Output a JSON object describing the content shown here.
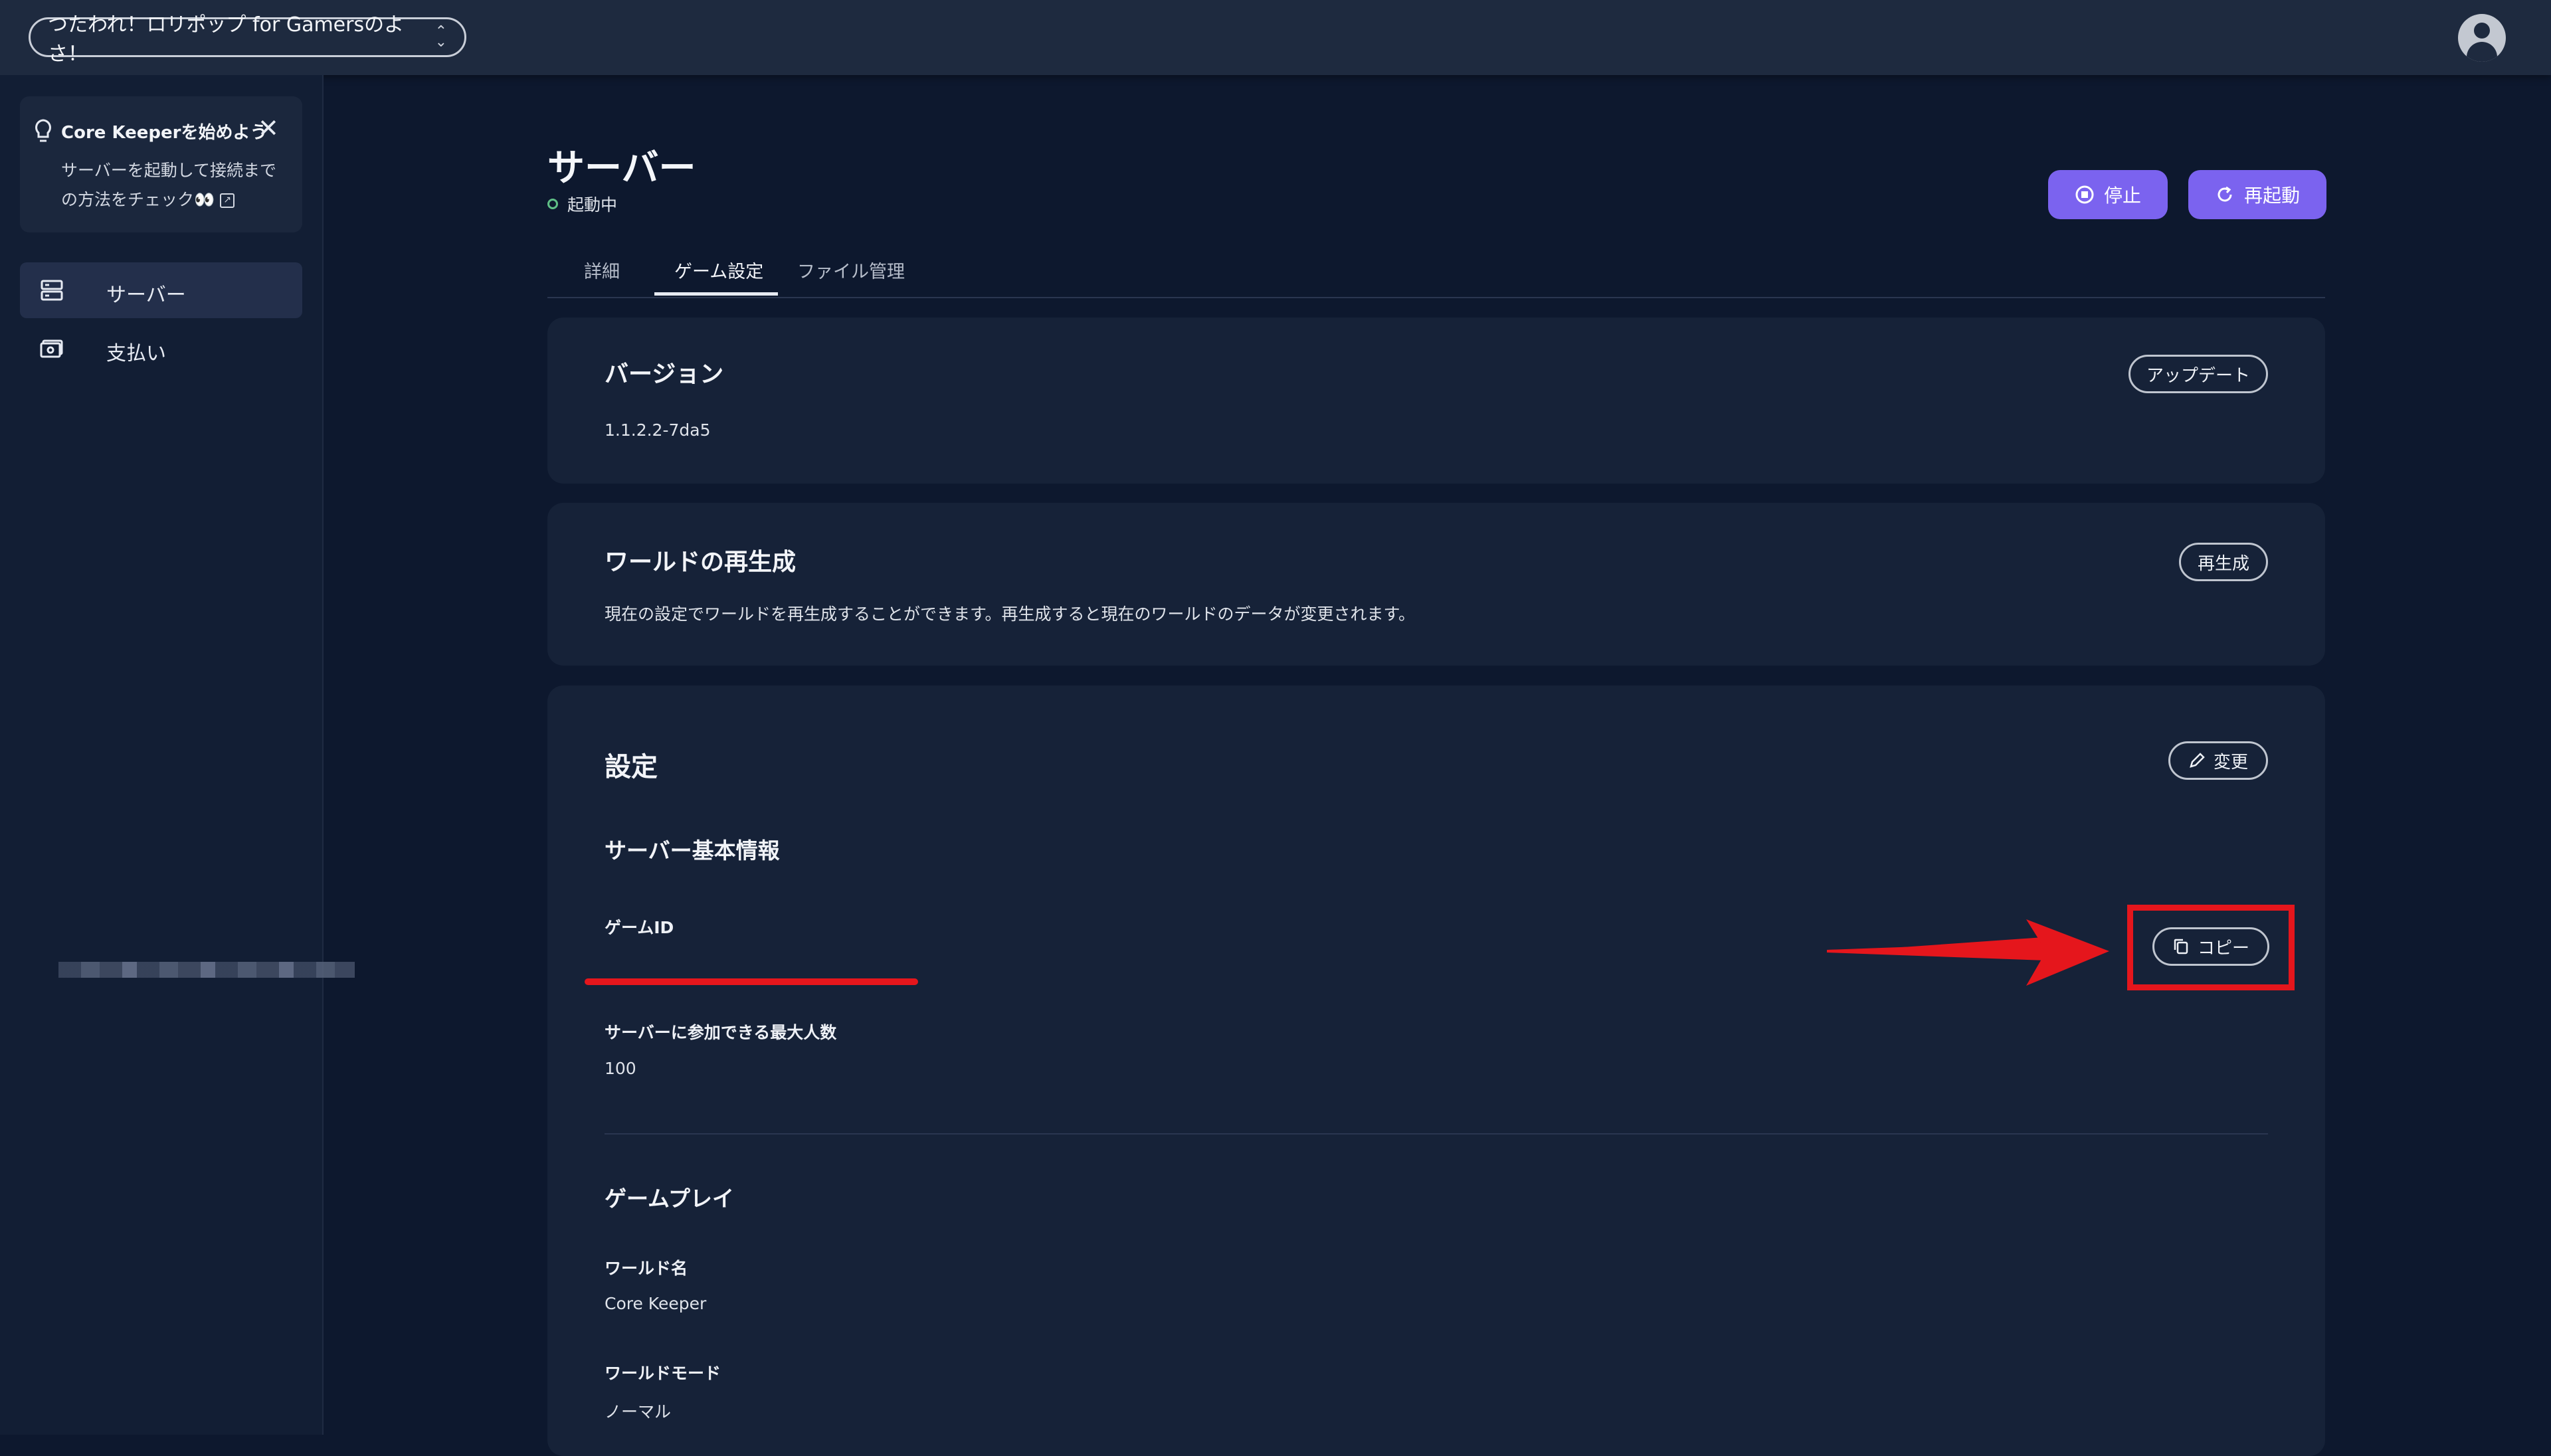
{
  "topbar": {
    "server_name": "つたわれ！ロリポップ for Gamersのよさ！",
    "select_icon": "chevron-up-down-icon",
    "avatar_icon": "user-avatar-icon"
  },
  "sidebar": {
    "tip": {
      "title": "Core Keeperを始めよう",
      "body_line1": "サーバーを起動して接続まで",
      "body_line2": "の方法をチェック👀",
      "icon": "lightbulb-icon",
      "close_icon": "close-icon"
    },
    "items": [
      {
        "label": "サーバー",
        "icon": "server-icon",
        "active": true
      },
      {
        "label": "支払い",
        "icon": "payment-icon",
        "active": false
      }
    ]
  },
  "header": {
    "title": "サーバー",
    "status": "起動中",
    "status_color": "#5fbf86",
    "stop_label": "停止",
    "restart_label": "再起動",
    "accent": "#7b63ef"
  },
  "tabs": [
    {
      "label": "詳細",
      "active": false
    },
    {
      "label": "ゲーム設定",
      "active": true
    },
    {
      "label": "ファイル管理",
      "active": false
    }
  ],
  "version_card": {
    "title": "バージョン",
    "value": "1.1.2.2-7da5",
    "button": "アップデート"
  },
  "regen_card": {
    "title": "ワールドの再生成",
    "description": "現在の設定でワールドを再生成することができます。再生成すると現在のワールドのデータが変更されます。",
    "button": "再生成"
  },
  "settings_card": {
    "title": "設定",
    "edit_button": "変更",
    "basic_section": "サーバー基本情報",
    "game_id_label": "ゲームID",
    "copy_button": "コピー",
    "max_players_label": "サーバーに参加できる最大人数",
    "max_players_value": "100",
    "gameplay_section": "ゲームプレイ",
    "world_name_label": "ワールド名",
    "world_name_value": "Core Keeper",
    "world_mode_label": "ワールドモード",
    "world_mode_value": "ノーマル"
  },
  "annotation_color": "#e5161c"
}
